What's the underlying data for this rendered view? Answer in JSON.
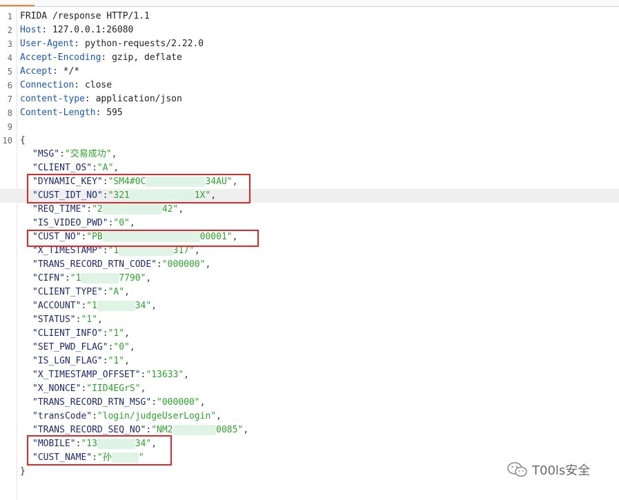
{
  "request_lines": [
    {
      "n": "1",
      "text": "FRIDA /response HTTP/1.1"
    },
    {
      "n": "2",
      "key": "Host",
      "value": "127.0.0.1:26080"
    },
    {
      "n": "3",
      "key": "User-Agent",
      "value": "python-requests/2.22.0"
    },
    {
      "n": "4",
      "key": "Accept-Encoding",
      "value": "gzip, deflate"
    },
    {
      "n": "5",
      "key": "Accept",
      "value": "*/*"
    },
    {
      "n": "6",
      "key": "Connection",
      "value": "close"
    },
    {
      "n": "7",
      "key": "content-type",
      "value": "application/json"
    },
    {
      "n": "8",
      "key": "Content-Length",
      "value": "595"
    },
    {
      "n": "9"
    },
    {
      "n": "10",
      "text": "{"
    }
  ],
  "json_body": [
    {
      "k": "\"MSG\"",
      "v": "\"交易成功\"",
      "tail": ","
    },
    {
      "k": "\"CLIENT_OS\"",
      "v": "\"A\"",
      "tail": ","
    },
    {
      "k": "\"DYNAMIC_KEY\"",
      "v1": "\"SM4#0C",
      "v2": "34AU\"",
      "tail": ","
    },
    {
      "k": "\"CUST_IDT_NO\"",
      "v1": "\"321",
      "v2": "1X\"",
      "tail": ","
    },
    {
      "k": "\"REQ_TIME\"",
      "v1": "\"2",
      "v2": "42\"",
      "tail": ","
    },
    {
      "k": "\"IS_VIDEO_PWD\"",
      "v": "\"0\"",
      "tail": ","
    },
    {
      "k": "\"CUST_NO\"",
      "v1": "\"PB",
      "v2": "00001\"",
      "tail": ","
    },
    {
      "k": "\"X_TIMESTAMP\"",
      "v1": "\"1",
      "v2": "317\"",
      "tail": ","
    },
    {
      "k": "\"TRANS_RECORD_RTN_CODE\"",
      "v": "\"000000\"",
      "tail": ","
    },
    {
      "k": "\"CIFN\"",
      "v1": "\"1",
      "v2": "7790\"",
      "tail": ","
    },
    {
      "k": "\"CLIENT_TYPE\"",
      "v": "\"A\"",
      "tail": ","
    },
    {
      "k": "\"ACCOUNT\"",
      "v1": "\"1",
      "v2": "34\"",
      "tail": ","
    },
    {
      "k": "\"STATUS\"",
      "v": "\"1\"",
      "tail": ","
    },
    {
      "k": "\"CLIENT_INFO\"",
      "v": "\"1\"",
      "tail": ","
    },
    {
      "k": "\"SET_PWD_FLAG\"",
      "v": "\"0\"",
      "tail": ","
    },
    {
      "k": "\"IS_LGN_FLAG\"",
      "v": "\"1\"",
      "tail": ","
    },
    {
      "k": "\"X_TIMESTAMP_OFFSET\"",
      "v": "\"13633\"",
      "tail": ","
    },
    {
      "k": "\"X_NONCE\"",
      "v": "\"IID4EGrS\"",
      "tail": ","
    },
    {
      "k": "\"TRANS_RECORD_RTN_MSG\"",
      "v": "\"000000\"",
      "tail": ","
    },
    {
      "k": "\"transCode\"",
      "v": "\"login/judgeUserLogin\"",
      "tail": ","
    },
    {
      "k": "\"TRANS_RECORD_SEQ_NO\"",
      "v1": "\"NM2",
      "v2": "0085\"",
      "tail": ","
    },
    {
      "k": "\"MOBILE\"",
      "v1": "\"13",
      "v2": "34\"",
      "tail": ","
    },
    {
      "k": "\"CUST_NAME\"",
      "v1": "\"孙",
      "v2": "\"",
      "tail": ""
    }
  ],
  "closing_brace": "}",
  "watermark": {
    "text": "T00ls安全",
    "icon": "wechat-icon"
  },
  "colors": {
    "highlight_box": "#e22626",
    "key": "#1f2a6e",
    "string": "#2aa52a",
    "header_key": "#1a57b4"
  }
}
